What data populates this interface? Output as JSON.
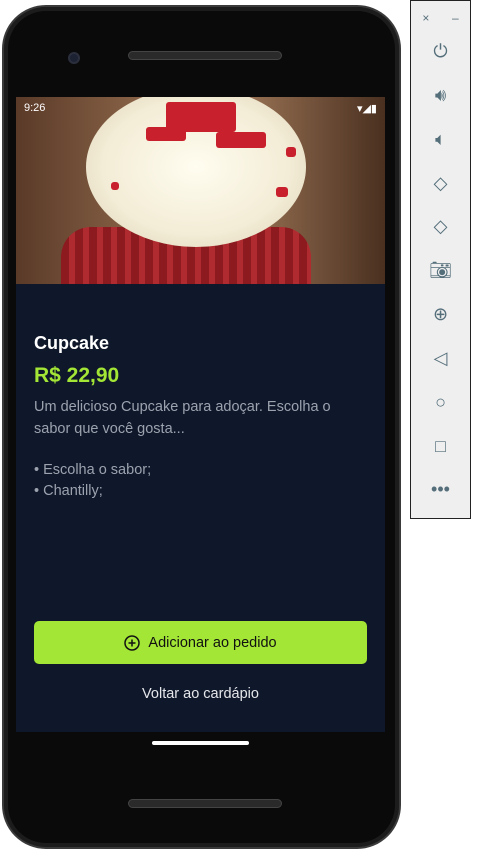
{
  "status_bar": {
    "time": "9:26"
  },
  "product": {
    "name": "Cupcake",
    "price": "R$ 22,90",
    "description": "Um delicioso Cupcake para adoçar. Escolha o sabor que você gosta...",
    "bullets": [
      "• Escolha o sabor;",
      "• Chantilly;"
    ]
  },
  "actions": {
    "add_label": "Adicionar ao pedido",
    "back_label": "Voltar ao cardápio"
  },
  "colors": {
    "accent": "#a3e635",
    "background": "#0f172a"
  },
  "emulator_toolbar": {
    "icons": [
      "close-icon",
      "minimize-icon",
      "power-icon",
      "volume-up-icon",
      "volume-down-icon",
      "rotate-left-icon",
      "rotate-right-icon",
      "camera-icon",
      "zoom-icon",
      "back-icon",
      "home-icon",
      "overview-icon",
      "more-icon"
    ]
  }
}
